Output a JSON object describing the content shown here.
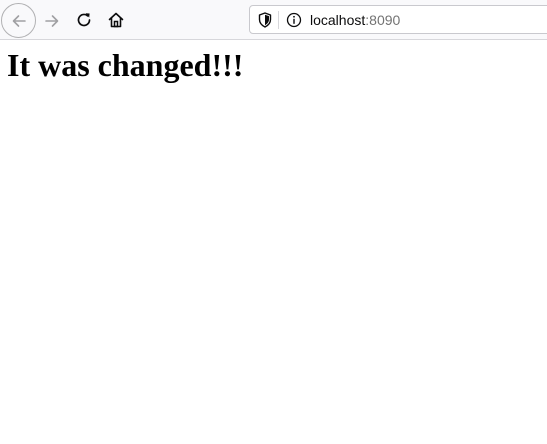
{
  "toolbar": {
    "back_icon": "arrow-left-icon",
    "forward_icon": "arrow-right-icon",
    "reload_icon": "reload-icon",
    "home_icon": "home-icon"
  },
  "urlbar": {
    "shield_icon": "shield-icon",
    "info_icon": "info-icon",
    "host": "localhost",
    "port": ":8090"
  },
  "page": {
    "heading": "It was changed!!!"
  },
  "colors": {
    "toolbar_bg": "#f9f9fb",
    "icon": "#0c0c0d",
    "icon_disabled": "#a0a0a3",
    "port_text": "#737373"
  }
}
